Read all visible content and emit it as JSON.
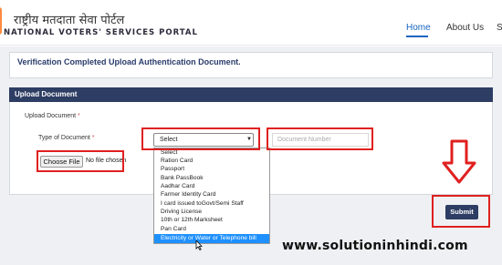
{
  "header": {
    "logo_hindi": "राष्ट्रीय मतदाता सेवा पोर्टल",
    "logo_english": "NATIONAL VOTERS' SERVICES PORTAL",
    "nav": {
      "home": "Home",
      "about": "About Us",
      "more": "S"
    }
  },
  "verify": {
    "message": "Verification Completed Upload Authentication Document."
  },
  "upload": {
    "section_title": "Upload Document",
    "upload_label": "Upload Document",
    "type_label": "Type of Document",
    "required_mark": "*",
    "select_value": "Select",
    "doc_number_placeholder": "Document Number",
    "choose_file_label": "Choose File",
    "no_file_text": "No file chosen",
    "options": [
      "Select",
      "Ration Card",
      "Passport",
      "Bank PassBook",
      "Aadhar Card",
      "Farmer Identity Card",
      "I card issued toGovt/Semi Staff",
      "Driving License",
      "10th or 12th Marksheet",
      "Pan Card",
      "Electricity or Water or Telephone bill"
    ],
    "highlighted_option": "Electricity or Water or Telephone bill",
    "submit_label": "Submit"
  },
  "watermark": "www.solutioninhindi.com",
  "colors": {
    "header_bar": "#2d3d63",
    "accent_blue": "#1565c0",
    "highlight": "#1e90ff",
    "annotation_red": "#e02020"
  }
}
